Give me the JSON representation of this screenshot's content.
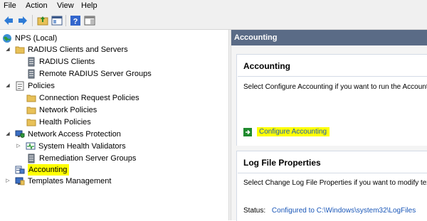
{
  "menu": [
    "File",
    "Action",
    "View",
    "Help"
  ],
  "toolbar": {
    "buttons": [
      "back-arrow-icon",
      "forward-arrow-icon",
      "up-folder-icon",
      "show-hide-tree-icon",
      "help-icon",
      "console-pane-icon"
    ]
  },
  "tree": {
    "root": "NPS (Local)",
    "radius_group": "RADIUS Clients and Servers",
    "radius_clients": "RADIUS Clients",
    "remote_groups": "Remote RADIUS Server Groups",
    "policies": "Policies",
    "connection_request": "Connection Request Policies",
    "network_policies": "Network Policies",
    "health_policies": "Health Policies",
    "nap": "Network Access Protection",
    "shv": "System Health Validators",
    "remediation": "Remediation Server Groups",
    "accounting": "Accounting",
    "templates": "Templates Management"
  },
  "details": {
    "header": "Accounting",
    "accounting_panel": {
      "title": "Accounting",
      "description": "Select Configure Accounting if you want to run the Account",
      "link": "Configure Accounting"
    },
    "log_panel": {
      "title": "Log File Properties",
      "description": "Select Change Log File Properties if you want to modify text",
      "status_label": "Status:",
      "status_value": "Configured to C:\\Windows\\system32\\LogFiles"
    }
  },
  "colors": {
    "highlight": "#ffff00",
    "header_bg": "#5a6b86",
    "link": "#1a57b8",
    "folder": "#e8c158"
  }
}
